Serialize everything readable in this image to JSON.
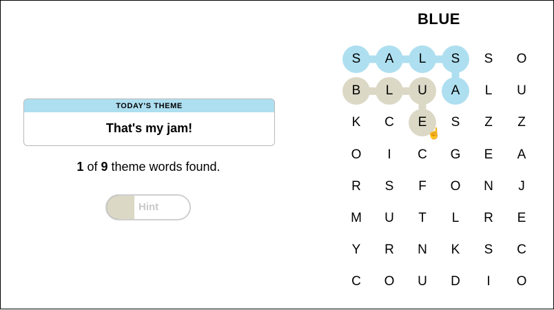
{
  "theme": {
    "header": "TODAY'S THEME",
    "value": "That's my jam!"
  },
  "progress": {
    "found": "1",
    "of_text": " of ",
    "total": "9",
    "suffix": " theme words found."
  },
  "hint": {
    "label": "Hint",
    "fill_fraction": 0.33
  },
  "board": {
    "title": "BLUE",
    "grid": [
      [
        "S",
        "A",
        "L",
        "S",
        "S",
        "O"
      ],
      [
        "B",
        "L",
        "U",
        "A",
        "L",
        "U"
      ],
      [
        "K",
        "C",
        "E",
        "S",
        "Z",
        "Z"
      ],
      [
        "O",
        "I",
        "C",
        "G",
        "E",
        "A"
      ],
      [
        "R",
        "S",
        "F",
        "O",
        "N",
        "J"
      ],
      [
        "M",
        "U",
        "T",
        "L",
        "R",
        "E"
      ],
      [
        "Y",
        "R",
        "N",
        "K",
        "S",
        "C"
      ],
      [
        "C",
        "O",
        "U",
        "D",
        "I",
        "O"
      ]
    ],
    "found_path": [
      [
        0,
        0
      ],
      [
        0,
        1
      ],
      [
        0,
        2
      ],
      [
        0,
        3
      ],
      [
        1,
        3
      ]
    ],
    "selection_path": [
      [
        1,
        0
      ],
      [
        1,
        1
      ],
      [
        1,
        2
      ],
      [
        2,
        2
      ]
    ],
    "colors": {
      "found": "#aedff0",
      "selection": "#dbd8c6"
    }
  },
  "cursor_icon": "hand-pointer-icon"
}
